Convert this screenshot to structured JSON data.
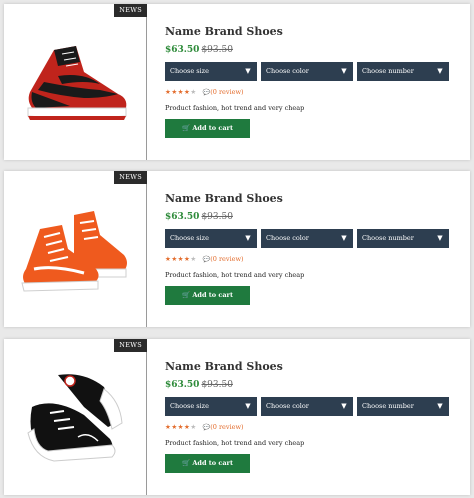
{
  "products": [
    {
      "badge": "NEWS",
      "title": "Name Brand Shoes",
      "price": "$63.50",
      "old_price": "$93.50",
      "selects": [
        {
          "label": "Choose size"
        },
        {
          "label": "Choose color"
        },
        {
          "label": "Choose number"
        }
      ],
      "rating": "4 of 5",
      "reviews": "(0 review)",
      "description": "Product fashion, hot trend and very cheap",
      "cart_label": "Add to cart",
      "shoe_colors": [
        "#1a1a1a",
        "#c0241c",
        "#ffffff"
      ]
    },
    {
      "badge": "NEWS",
      "title": "Name Brand Shoes",
      "price": "$63.50",
      "old_price": "$93.50",
      "selects": [
        {
          "label": "Choose size"
        },
        {
          "label": "Choose color"
        },
        {
          "label": "Choose number"
        }
      ],
      "rating": "4 of 5",
      "reviews": "(0 review)",
      "description": "Product fashion, hot trend and very cheap",
      "cart_label": "Add to cart",
      "shoe_colors": [
        "#ef5a1e",
        "#ffffff",
        "#d9d9d9"
      ]
    },
    {
      "badge": "NEWS",
      "title": "Name Brand Shoes",
      "price": "$63.50",
      "old_price": "$93.50",
      "selects": [
        {
          "label": "Choose size"
        },
        {
          "label": "Choose color"
        },
        {
          "label": "Choose number"
        }
      ],
      "rating": "4 of 5",
      "reviews": "(0 review)",
      "description": "Product fashion, hot trend and very cheap",
      "cart_label": "Add to cart",
      "shoe_colors": [
        "#111111",
        "#ffffff",
        "#c0241c"
      ]
    }
  ],
  "theme": {
    "select_bg": "#2d3e50",
    "cart_bg": "#1f7a3e",
    "price_color": "#2e8b3a",
    "star_color": "#e36c2c"
  }
}
